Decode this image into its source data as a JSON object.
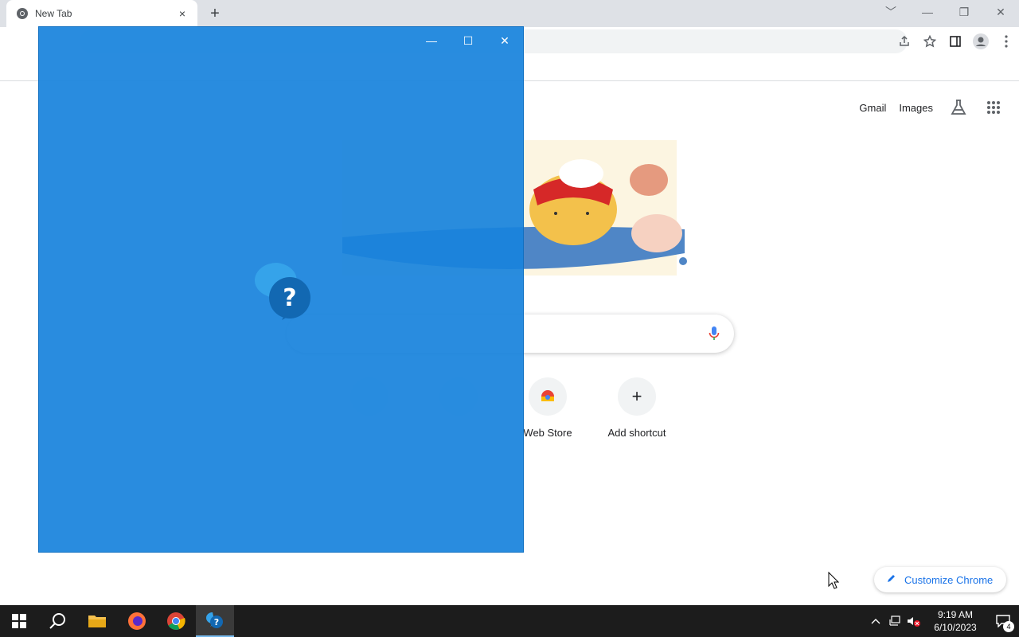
{
  "browser": {
    "tab_title": "New Tab",
    "close_glyph": "×",
    "newtab_glyph": "+",
    "window_controls": [
      "﹀",
      "—",
      "❐",
      "✕"
    ]
  },
  "ntp": {
    "gmail": "Gmail",
    "images": "Images",
    "search_placeholder": "",
    "shortcuts": [
      {
        "label": "Web Store"
      },
      {
        "label": "Add shortcut",
        "glyph": "+"
      }
    ],
    "customize": "Customize Chrome"
  },
  "overlay": {
    "controls": [
      "—",
      "☐",
      "✕"
    ],
    "help_glyph": "?"
  },
  "taskbar": {
    "time": "9:19 AM",
    "date": "6/10/2023",
    "notification_count": "4",
    "help_badge": "?"
  },
  "colors": {
    "overlay_blue": "#1983dd",
    "accent": "#1a73e8",
    "taskbar": "#1c1c1c"
  }
}
